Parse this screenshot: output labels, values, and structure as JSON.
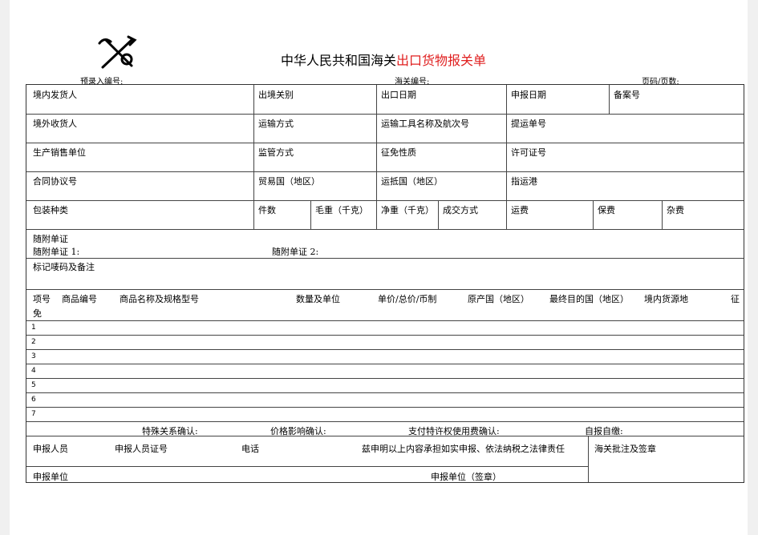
{
  "title": {
    "black": "中华人民共和国海关",
    "red": "出口货物报关单"
  },
  "top": {
    "preentry": "预录入编号:",
    "customs_no": "海关编号:",
    "page": "页码/页数:"
  },
  "r1": [
    "境内发货人",
    "出境关别",
    "出口日期",
    "申报日期",
    "备案号"
  ],
  "r2": [
    "境外收货人",
    "运输方式",
    "运输工具名称及航次号",
    "提运单号"
  ],
  "r3": [
    "生产销售单位",
    "监管方式",
    "征免性质",
    "许可证号"
  ],
  "r4": [
    "合同协议号",
    "贸易国（地区）",
    "运抵国（地区）",
    "指运港"
  ],
  "r5": [
    "包装种类",
    "件数",
    "毛重（千克）",
    "净重（千克）",
    "成交方式",
    "运费",
    "保费",
    "杂费"
  ],
  "docs": {
    "title": "随附单证",
    "d1": "随附单证 1:",
    "d2": "随附单证 2:"
  },
  "marks": "标记唛码及备注",
  "items_header": [
    "项号",
    "商品编号",
    "商品名称及规格型号",
    "数量及单位",
    "单价/总价/币制",
    "原产国（地区）",
    "最终目的国（地区）",
    "境内货源地",
    "征",
    "免"
  ],
  "rows": [
    "1",
    "2",
    "3",
    "4",
    "5",
    "6",
    "7"
  ],
  "confirm": [
    "特殊关系确认:",
    "价格影响确认:",
    "支付特许权使用费确认:",
    "自报自缴:"
  ],
  "bottom": {
    "declarant": "申报人员",
    "declarant_id": "申报人员证号",
    "phone": "电话",
    "statement": "兹申明以上内容承担如实申报、依法纳税之法律责任",
    "customs_note": "海关批注及签章",
    "unit": "申报单位",
    "unit_seal": "申报单位（签章）"
  }
}
